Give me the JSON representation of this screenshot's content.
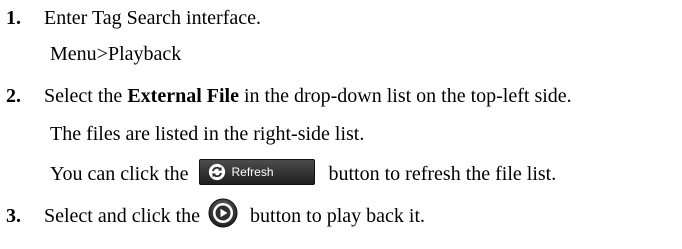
{
  "steps": [
    {
      "number": "1.",
      "text": "Enter Tag Search interface.",
      "sub": "Menu>Playback"
    },
    {
      "number": "2.",
      "text_before": "Select the ",
      "text_bold": "External File",
      "text_after": " in the drop-down list on the top-left side.",
      "sub1": "The files are listed in the right-side list.",
      "sub2_before": "You can click the",
      "sub2_after": "button to refresh the file list."
    },
    {
      "number": "3.",
      "text_before": "Select and click the",
      "text_after": "button to play back it."
    }
  ],
  "refresh_button": {
    "label": "Refresh",
    "icon": "refresh-icon"
  },
  "play_button": {
    "icon": "play-icon"
  },
  "colors": {
    "text": "#000000",
    "button_bg": "#2e2e2e",
    "button_text": "#ffffff",
    "play_icon_ring": "#3a3a3a"
  }
}
